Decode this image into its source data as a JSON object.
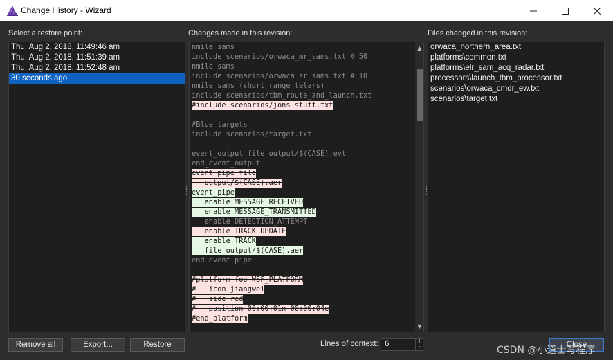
{
  "window": {
    "title": "Change History - Wizard",
    "app_icon": "wizard-hat-icon"
  },
  "labels": {
    "restore_points": "Select a restore point:",
    "changes": "Changes made in this revision:",
    "files": "Files changed in this revision:"
  },
  "restore_points": [
    {
      "label": "Thu, Aug 2, 2018, 11:49:46 am",
      "selected": false
    },
    {
      "label": "Thu, Aug 2, 2018, 11:51:39 am",
      "selected": false
    },
    {
      "label": "Thu, Aug 2, 2018, 11:52:48 am",
      "selected": false
    },
    {
      "label": "30 seconds ago",
      "selected": true
    }
  ],
  "diff_lines": [
    {
      "text": "nmile sams",
      "type": "context"
    },
    {
      "text": "include scenarios/orwaca_mr_sams.txt # 50",
      "type": "context"
    },
    {
      "text": "nmile sams",
      "type": "context"
    },
    {
      "text": "include scenarios/orwaca_sr_sams.txt # 10",
      "type": "context"
    },
    {
      "text": "nmile sams (short range telars)",
      "type": "context"
    },
    {
      "text": "include scenarios/tbm_route_and_launch.txt",
      "type": "context"
    },
    {
      "text": "#include scenarios/jons_stuff.txt",
      "type": "removed"
    },
    {
      "text": "",
      "type": "context"
    },
    {
      "text": "#Blue targets",
      "type": "context"
    },
    {
      "text": "include scenarios/target.txt",
      "type": "context"
    },
    {
      "text": "",
      "type": "context"
    },
    {
      "text": "event_output file output/$(CASE).evt",
      "type": "context"
    },
    {
      "text": "end_event_output",
      "type": "context"
    },
    {
      "text": "event_pipe file",
      "type": "removed"
    },
    {
      "text": "   output/$(CASE).aer",
      "type": "removed"
    },
    {
      "text": "event_pipe",
      "type": "added"
    },
    {
      "text": "   enable MESSAGE_RECEIVED",
      "type": "added"
    },
    {
      "text": "   enable MESSAGE_TRANSMITTED",
      "type": "added"
    },
    {
      "text": "   enable DETECTION_ATTEMPT",
      "type": "context"
    },
    {
      "text": "   enable TRACK_UPDATE",
      "type": "removed"
    },
    {
      "text": "   enable TRACK",
      "type": "added"
    },
    {
      "text": "   file output/$(CASE).aer",
      "type": "added"
    },
    {
      "text": "end_event_pipe",
      "type": "context"
    },
    {
      "text": "",
      "type": "context"
    },
    {
      "text": "#platform foo WSF_PLATFORM",
      "type": "removed"
    },
    {
      "text": "#   icon jiangwei",
      "type": "removed"
    },
    {
      "text": "#   side red",
      "type": "removed"
    },
    {
      "text": "#   position 00:00:01n 00:00:04e",
      "type": "removed"
    },
    {
      "text": "#end_platform",
      "type": "removed"
    }
  ],
  "files_changed": [
    "orwaca_northern_area.txt",
    "platforms\\common.txt",
    "platforms\\elr_sam_acq_radar.txt",
    "processors\\launch_tbm_processor.txt",
    "scenarios\\orwaca_cmdr_ew.txt",
    "scenarios\\target.txt"
  ],
  "buttons": {
    "remove_all": "Remove all",
    "export": "Export...",
    "restore": "Restore",
    "close": "Close"
  },
  "context": {
    "label": "Lines of context:",
    "value": "6"
  },
  "watermark": "CSDN @小道士写程序",
  "colors": {
    "removed_bg": "#fde2e2",
    "added_bg": "#e4f8e4",
    "selection": "#0e63c2",
    "panel_bg": "#1e1e1e",
    "window_bg": "#2d2d30"
  }
}
